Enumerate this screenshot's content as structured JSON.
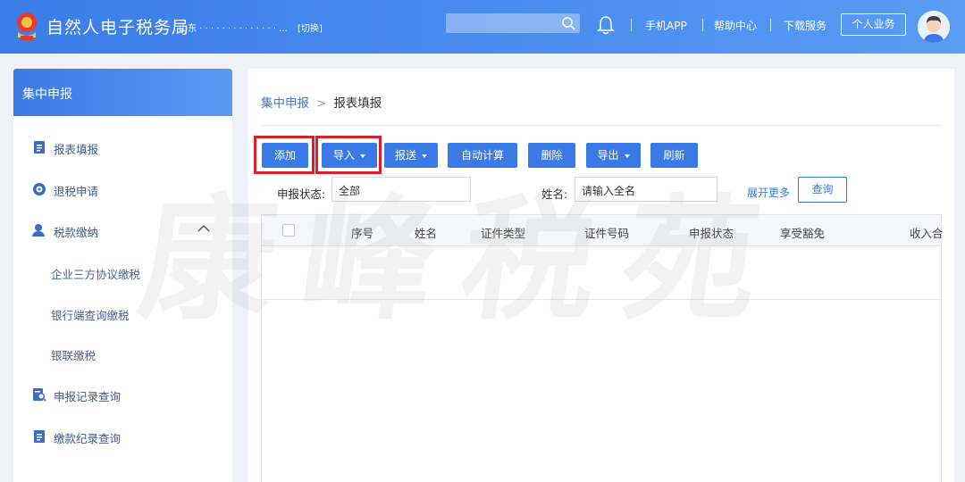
{
  "header": {
    "title": "自然人电子税务局",
    "region": "山东 · · · · · · · · · · · · · · ...",
    "switch_label": "[切换]",
    "links": [
      "手机APP",
      "帮助中心",
      "下载服务"
    ],
    "personal_button": "个人业务"
  },
  "sidebar": {
    "title": "集中申报",
    "items": [
      {
        "label": "报表填报",
        "icon": "document-icon"
      },
      {
        "label": "退税申请",
        "icon": "refund-icon"
      },
      {
        "label": "税款缴纳",
        "icon": "user-pay-icon"
      },
      {
        "label": "申报记录查询",
        "icon": "search-document-icon"
      },
      {
        "label": "缴款纪录查询",
        "icon": "document-icon"
      }
    ],
    "subitems": [
      "企业三方协议缴税",
      "银行端查询缴税",
      "银联缴税"
    ]
  },
  "breadcrumb": {
    "home": "集中申报",
    "separator": ">",
    "current": "报表填报"
  },
  "toolbar": {
    "add": "添加",
    "import": "导入",
    "submit": "报送",
    "auto_calc": "自动计算",
    "delete": "删除",
    "export": "导出",
    "refresh": "刷新"
  },
  "filters": {
    "status_label": "申报状态:",
    "status_value": "全部",
    "name_label": "姓名:",
    "name_placeholder": "请输入全名",
    "more": "展开更多",
    "query": "查询"
  },
  "table": {
    "columns": [
      "序号",
      "姓名",
      "证件类型",
      "证件号码",
      "申报状态",
      "享受豁免",
      "收入合"
    ]
  },
  "watermark": "康峰税苑",
  "colors": {
    "primary": "#3a7ae6",
    "highlight": "#d9202a",
    "header": "#4b8ef0"
  }
}
